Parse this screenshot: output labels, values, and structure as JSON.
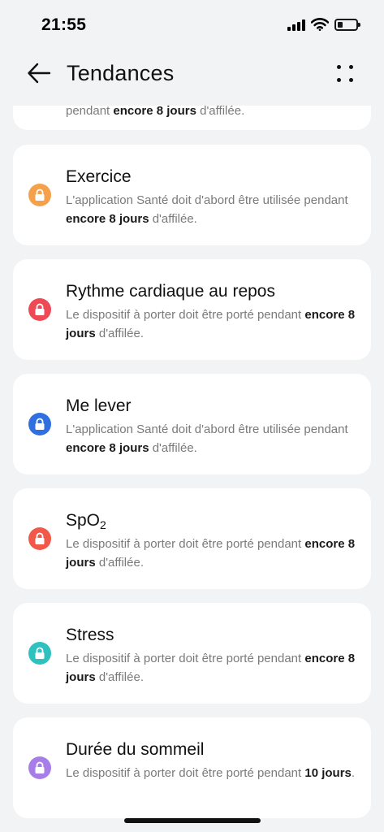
{
  "status_bar": {
    "time": "21:55"
  },
  "header": {
    "title": "Tendances"
  },
  "partial_card": {
    "desc_pre": "pendant ",
    "desc_bold": "encore 8 jours",
    "desc_post": " d'affilée."
  },
  "cards": [
    {
      "title": "Exercice",
      "desc_pre": "L'application Santé doit d'abord être utilisée pendant ",
      "desc_bold": "encore 8 jours",
      "desc_post": " d'affilée.",
      "icon_color": "#f5a04a"
    },
    {
      "title": "Rythme cardiaque au repos",
      "desc_pre": "Le dispositif à porter doit être porté pendant ",
      "desc_bold": "encore 8 jours",
      "desc_post": " d'affilée.",
      "icon_color": "#ee4a55"
    },
    {
      "title": "Me lever",
      "desc_pre": "L'application Santé doit d'abord être utilisée pendant ",
      "desc_bold": "encore 8 jours",
      "desc_post": " d'affilée.",
      "icon_color": "#2f6fe0"
    },
    {
      "title_main": "SpO",
      "title_sub": "2",
      "desc_pre": "Le dispositif à porter doit être porté pendant ",
      "desc_bold": "encore 8 jours",
      "desc_post": " d'affilée.",
      "icon_color": "#f2584a"
    },
    {
      "title": "Stress",
      "desc_pre": "Le dispositif à porter doit être porté pendant ",
      "desc_bold": "encore 8 jours",
      "desc_post": " d'affilée.",
      "icon_color": "#2fc1bd"
    },
    {
      "title": "Durée du sommeil",
      "desc_pre": "Le dispositif à porter doit être porté pendant ",
      "desc_bold": "10 jours",
      "desc_post": ".",
      "icon_color": "#a77ee8"
    }
  ],
  "icons": {
    "back": "arrow-left-icon",
    "more": "four-dots-icon",
    "lock": "lock-icon",
    "signal": "cellular-signal-icon",
    "wifi": "wifi-icon",
    "battery": "battery-icon"
  }
}
